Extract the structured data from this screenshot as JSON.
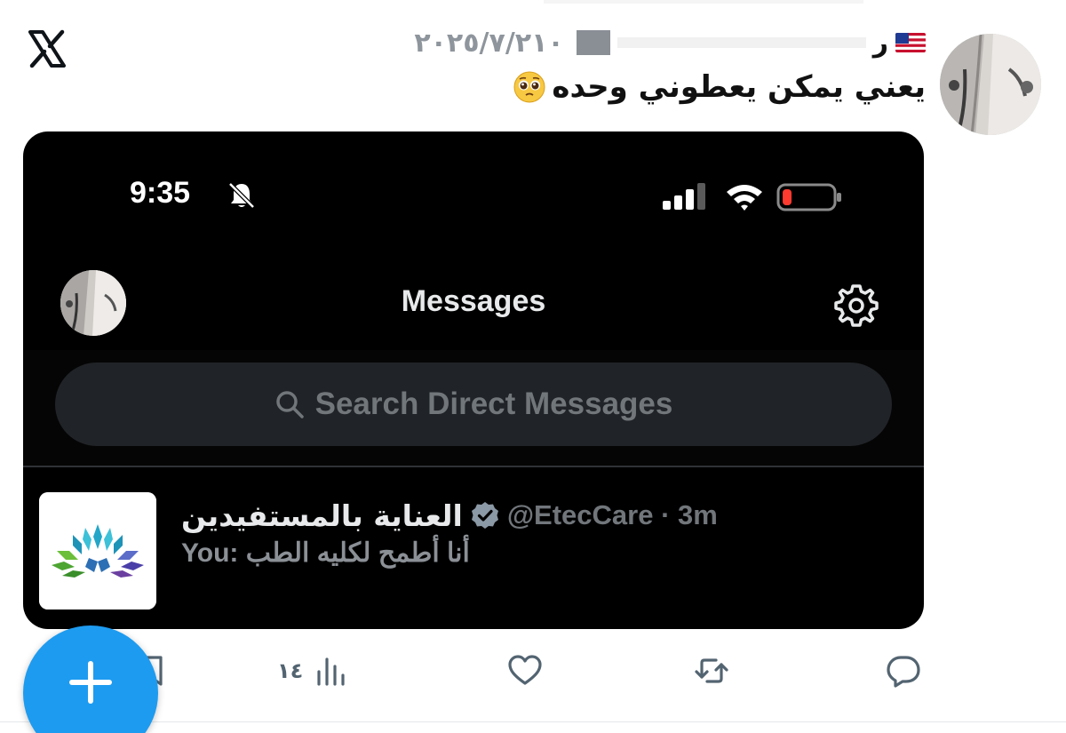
{
  "tweet": {
    "date": "٢٠٢٥/٧/٢١٠",
    "name_initial": "ر",
    "text": "يعني يمكن يعطوني وحده",
    "emoji": "pleading-face-emoji"
  },
  "phone": {
    "status_time": "9:35",
    "status_icons": [
      "bell-slash-icon",
      "signal-icon",
      "wifi-icon",
      "battery-low-icon"
    ],
    "battery_color": "#ff3b30",
    "title": "Messages",
    "search_placeholder": "Search Direct Messages",
    "conversation": {
      "name": "العناية بالمستفيدين",
      "handle": "@EtecCare · 3m",
      "preview": "You: أنا أطمح لكليه الطب"
    }
  },
  "actions": {
    "views_count": "١٤",
    "accent_color": "#1d9bf0",
    "icons": [
      "reply-icon",
      "retweet-icon",
      "like-icon",
      "views-icon",
      "bookmark-icon"
    ]
  }
}
